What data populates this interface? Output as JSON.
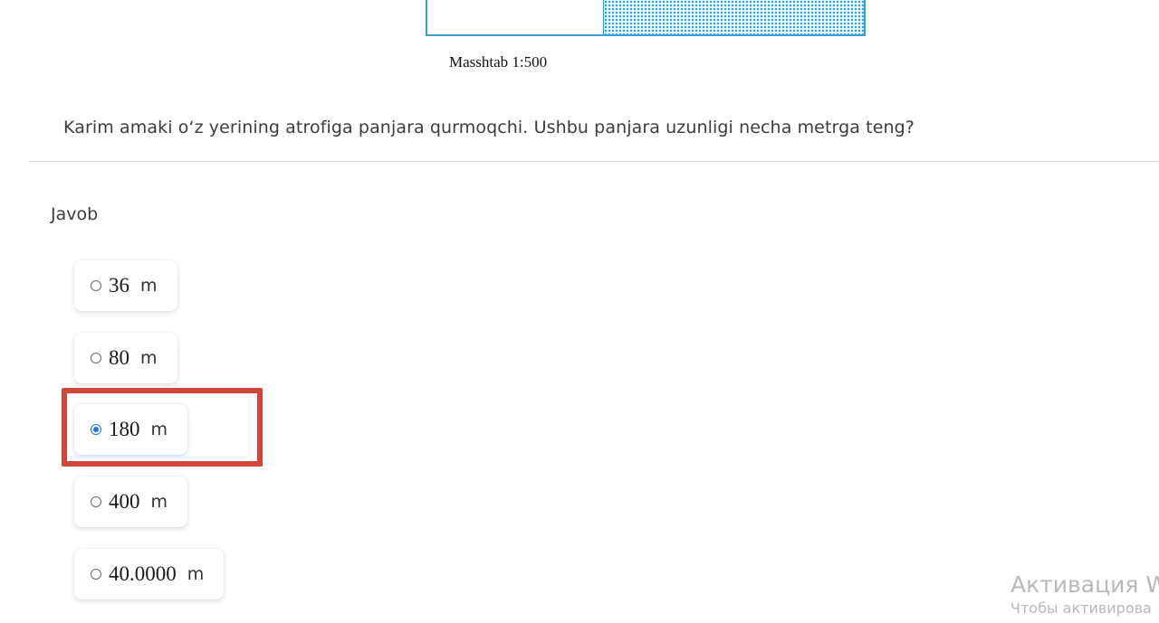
{
  "diagram": {
    "scale_caption": "Masshtab 1:500"
  },
  "question": {
    "text": "Karim amaki o‘z yerining atrofiga panjara qurmoqchi. Ushbu panjara uzunligi necha metrga teng?"
  },
  "answer": {
    "label": "Javob",
    "options": [
      {
        "value": "36",
        "unit": "m",
        "selected": false
      },
      {
        "value": "80",
        "unit": "m",
        "selected": false
      },
      {
        "value": "180",
        "unit": "m",
        "selected": true
      },
      {
        "value": "400",
        "unit": "m",
        "selected": false
      },
      {
        "value": "40.0000",
        "unit": "m",
        "selected": false
      }
    ]
  },
  "colors": {
    "diagram_stroke": "#3aa0dc",
    "highlight": "#d0463b",
    "radio_checked": "#1a73e8"
  },
  "watermark": {
    "title": "Активация W",
    "subtitle": "Чтобы активирова"
  }
}
